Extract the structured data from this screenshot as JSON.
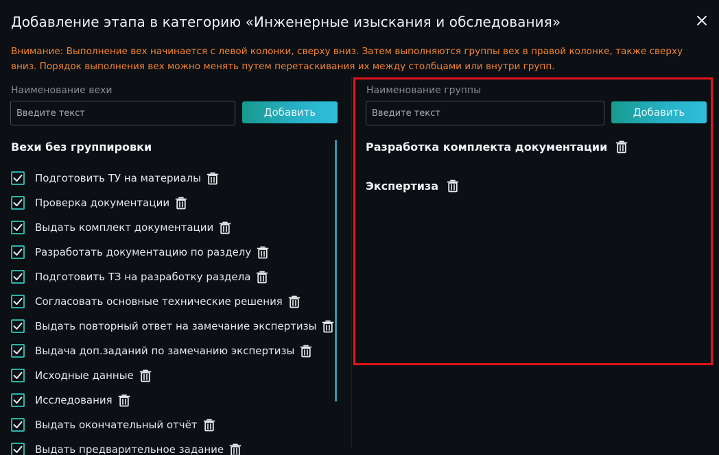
{
  "dialog": {
    "title": "Добавление этапа в категорию «Инженерные изыскания и обследования»",
    "warning": "Внимание: Выполнение вех начинается с левой колонки, сверху вниз. Затем выполняются группы вех в правой колонке, также сверху вниз. Порядок выполнения вех можно менять путем перетаскивания их между столбцами или внутри групп."
  },
  "left": {
    "field_label": "Наименование вехи",
    "placeholder": "Введите текст",
    "add_label": "Добавить",
    "section_title": "Вехи без группировки",
    "milestones": [
      "Подготовить ТУ на материалы",
      "Проверка документации",
      "Выдать комплект документации",
      "Разработать документацию по разделу",
      "Подготовить ТЗ на разработку раздела",
      "Согласовать основные технические решения",
      "Выдать повторный ответ на замечание экспертизы",
      "Выдача доп.заданий по замечанию экспертизы",
      "Исходные данные",
      "Исследования",
      "Выдать окончательный отчёт",
      "Выдать предварительное задание"
    ]
  },
  "right": {
    "field_label": "Наименование группы",
    "placeholder": "Введите текст",
    "add_label": "Добавить",
    "groups": [
      "Разработка комплекта документации",
      "Экспертиза"
    ]
  },
  "colors": {
    "accent_teal": "#2fb3a7",
    "warning": "#f3832f",
    "highlight_frame": "#e4141c"
  },
  "icons": {
    "close": "close-icon",
    "check": "check-icon",
    "trash": "trash-icon"
  }
}
